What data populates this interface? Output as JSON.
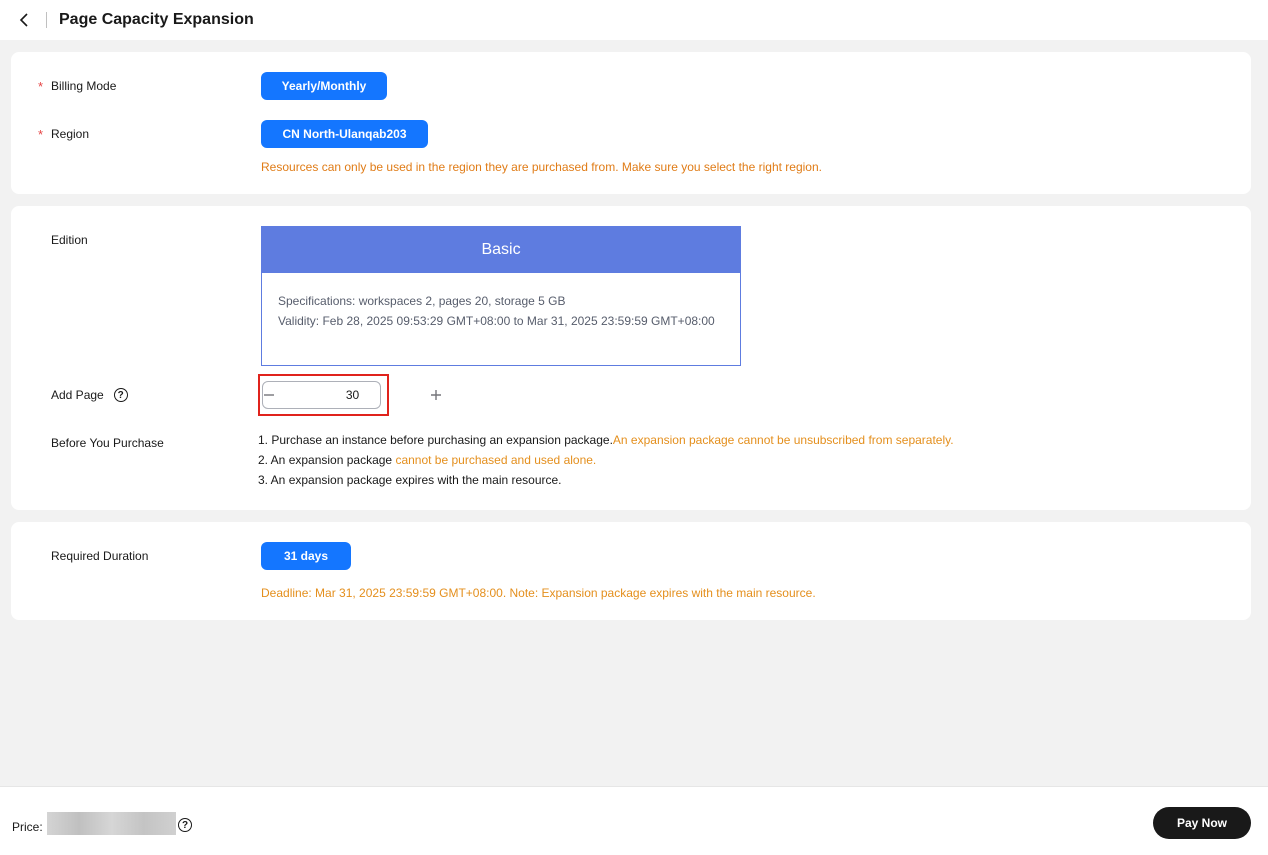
{
  "header": {
    "back_icon": "chevron-left-icon",
    "title": "Page Capacity Expansion"
  },
  "billing": {
    "label": "Billing Mode",
    "value": "Yearly/Monthly"
  },
  "region": {
    "label": "Region",
    "value": "CN North-Ulanqab203",
    "hint": "Resources can only be used in the region they are purchased from. Make sure you select the right region."
  },
  "edition": {
    "label": "Edition",
    "name": "Basic",
    "specifications": "Specifications: workspaces 2, pages 20, storage 5 GB",
    "validity": "Validity: Feb 28, 2025 09:53:29 GMT+08:00 to Mar 31, 2025 23:59:59 GMT+08:00"
  },
  "add_page": {
    "label": "Add Page",
    "value": "30",
    "help_icon": "question-circle-icon"
  },
  "before_purchase": {
    "label": "Before You Purchase",
    "note1_prefix": "1. Purchase an instance before purchasing an expansion package.",
    "note1_warn": "An expansion package cannot be unsubscribed from separately.",
    "note2_prefix": "2. An expansion package ",
    "note2_warn": "cannot be purchased and used alone.",
    "note3": "3. An expansion package expires with the main resource."
  },
  "duration": {
    "label": "Required Duration",
    "value": "31 days",
    "hint": "Deadline: Mar 31, 2025 23:59:59 GMT+08:00. Note: Expansion package expires with the main resource."
  },
  "footer": {
    "price_label": "Price:",
    "pay_button": "Pay Now",
    "help_icon": "question-circle-icon"
  },
  "colors": {
    "accent": "#1476ff",
    "edition_header": "#5e7ce0",
    "warning": "#e48f1d",
    "highlight": "#e0231c",
    "pay_button": "#191919"
  }
}
